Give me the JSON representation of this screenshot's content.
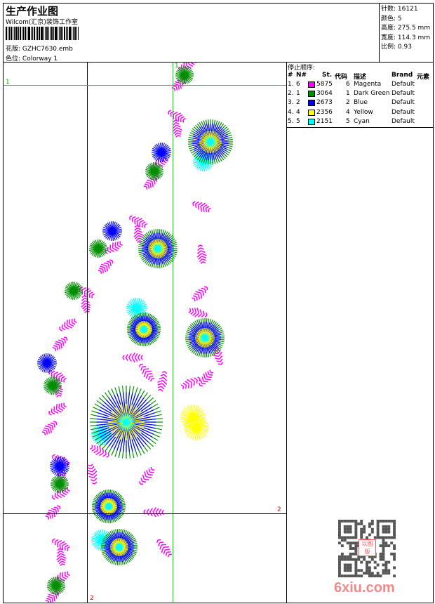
{
  "header": {
    "title": "生产作业图",
    "company": "Wilcom(汇京)装饰工作室",
    "design_label": "花版:",
    "design_value": "GZHC7630.emb",
    "colorway_label": "色位:",
    "colorway_value": "Colorway 1"
  },
  "info": [
    {
      "label": "针数:",
      "value": "16121"
    },
    {
      "label": "颜色:",
      "value": "5"
    },
    {
      "label": "高度:",
      "value": "275.5 mm"
    },
    {
      "label": "宽度:",
      "value": "114.3 mm"
    },
    {
      "label": "比例:",
      "value": "0.93"
    }
  ],
  "stop_sequence": {
    "title": "停止顺序:",
    "headers": [
      "#",
      "N#",
      "St.",
      "代码",
      "描述",
      "Brand",
      "元素"
    ],
    "rows": [
      {
        "idx": "1.",
        "n": "6",
        "color": "#ff00ff",
        "st": "5875",
        "code": "6",
        "desc": "Magenta",
        "brand": "Default"
      },
      {
        "idx": "2.",
        "n": "1",
        "color": "#008f00",
        "st": "3064",
        "code": "1",
        "desc": "Dark Green",
        "brand": "Default"
      },
      {
        "idx": "3.",
        "n": "2",
        "color": "#0000ff",
        "st": "2673",
        "code": "2",
        "desc": "Blue",
        "brand": "Default"
      },
      {
        "idx": "4.",
        "n": "4",
        "color": "#ffff00",
        "st": "2356",
        "code": "4",
        "desc": "Yellow",
        "brand": "Default"
      },
      {
        "idx": "5.",
        "n": "5",
        "color": "#00ffff",
        "st": "2151",
        "code": "5",
        "desc": "Cyan",
        "brand": "Default"
      }
    ]
  },
  "guides": {
    "v1": "1",
    "h1": "1",
    "h2": "2",
    "v2": "2"
  },
  "watermark": {
    "site": "6xiu.com",
    "stamp": "以图版"
  }
}
